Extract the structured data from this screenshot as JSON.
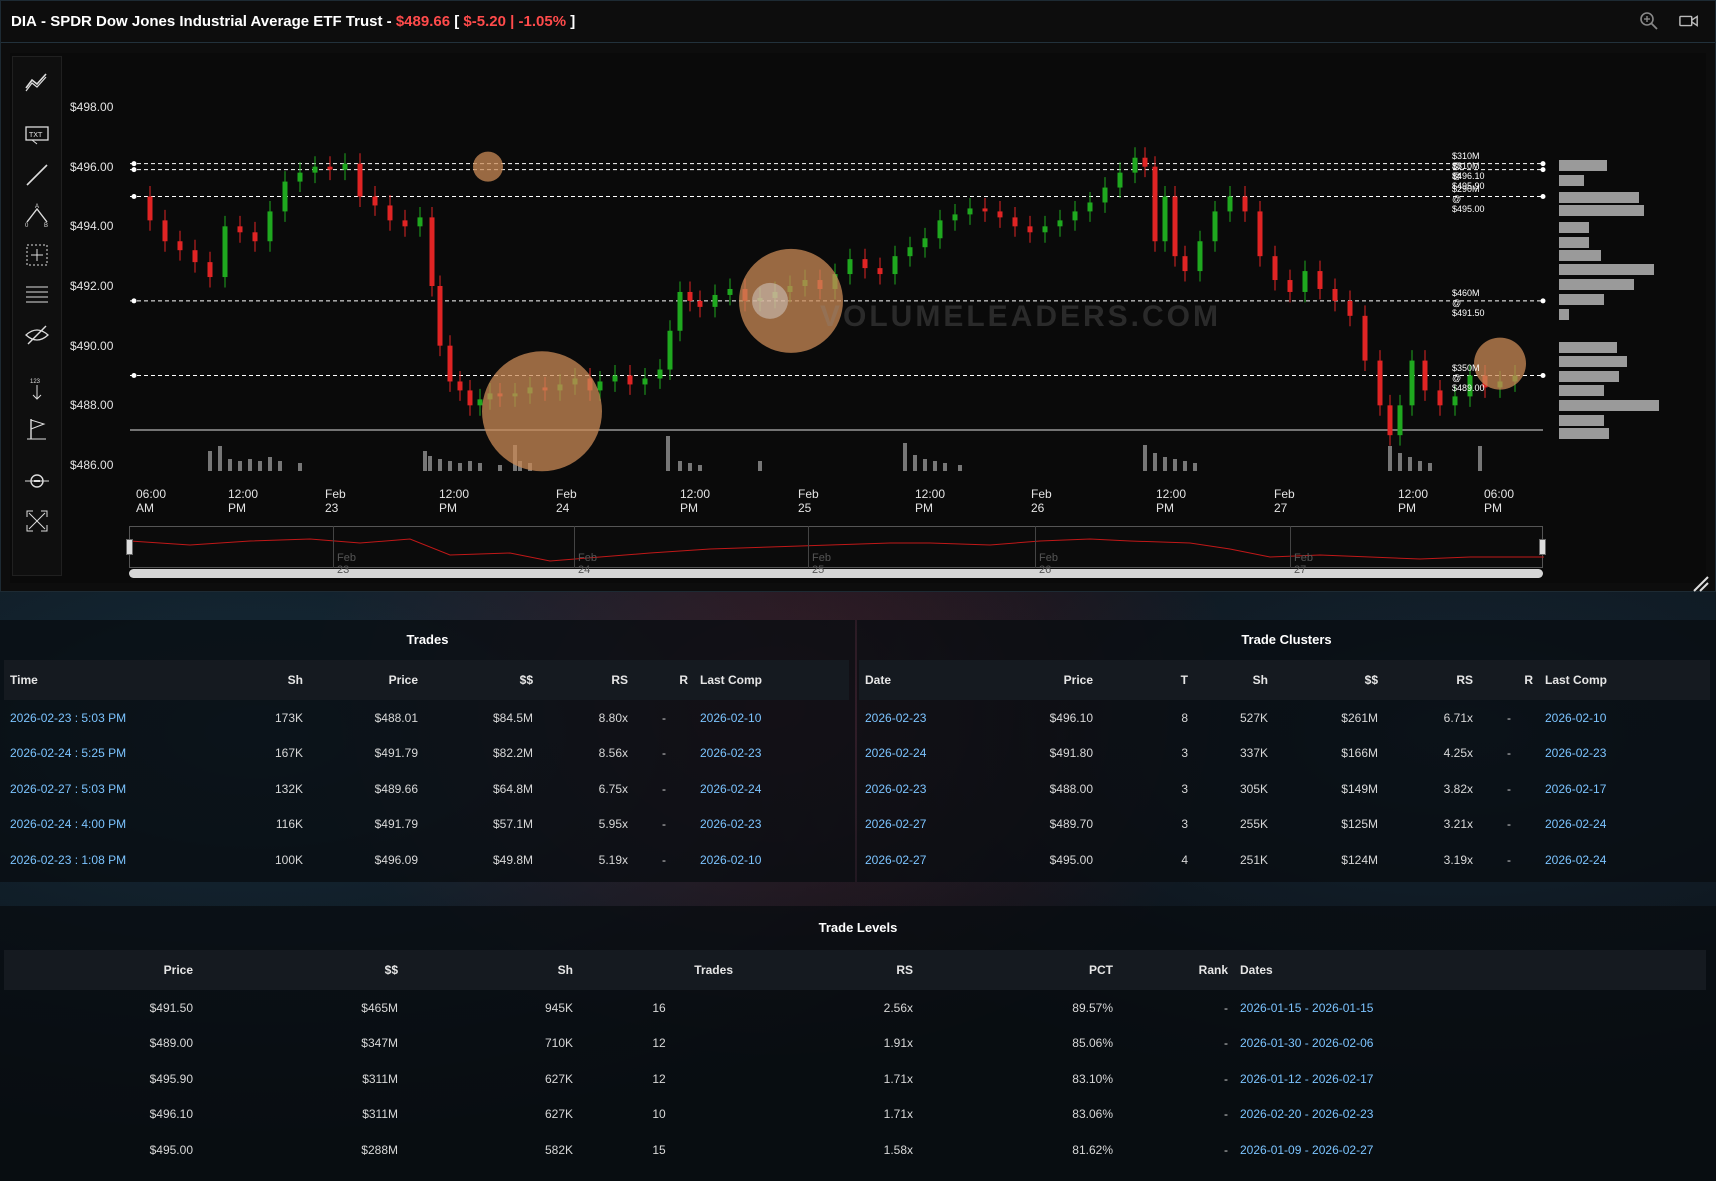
{
  "header": {
    "symbol": "DIA",
    "separator": " - ",
    "name": "SPDR Dow Jones Industrial Average ETF Trust",
    "dash": " - ",
    "price": "$489.66",
    "bracket_open": " [ ",
    "change": "$-5.20",
    "pipe": " | ",
    "change_pct": "-1.05%",
    "bracket_close": " ]"
  },
  "chart_data": {
    "type": "candlestick",
    "y_ticks": [
      "$498.00",
      "$496.00",
      "$494.00",
      "$492.00",
      "$490.00",
      "$488.00",
      "$486.00"
    ],
    "x_ticks": [
      "06:00 AM",
      "12:00 PM",
      "Feb 23",
      "12:00 PM",
      "Feb 24",
      "12:00 PM",
      "Feb 25",
      "12:00 PM",
      "Feb 26",
      "12:00 PM",
      "Feb 27",
      "12:00 PM",
      "06:00 PM"
    ],
    "ylim": [
      486,
      498.5
    ],
    "levels": [
      {
        "label": "$310M @ $496.10",
        "price": 496.1
      },
      {
        "label": "$310M @ $495.90",
        "price": 495.9
      },
      {
        "label": "$290M @ $495.00",
        "price": 495.0
      },
      {
        "label": "$460M @ $491.50",
        "price": 491.5
      },
      {
        "label": "$350M @ $489.00",
        "price": 489.0
      }
    ],
    "watermark": "VOLUMELEADERS.COM",
    "navigator_labels": [
      "Feb 23",
      "Feb 24",
      "Feb 25",
      "Feb 26",
      "Feb 27"
    ],
    "colors": {
      "up": "#1fa81f",
      "down": "#e02424",
      "bubble": "#c98a55"
    }
  },
  "trades": {
    "title": "Trades",
    "columns": [
      "Time",
      "Sh",
      "Price",
      "$$",
      "RS",
      "R",
      "Last Comp"
    ],
    "rows": [
      [
        "2026-02-23 : 5:03 PM",
        "173K",
        "$488.01",
        "$84.5M",
        "8.80x",
        "-",
        "2026-02-10"
      ],
      [
        "2026-02-24 : 5:25 PM",
        "167K",
        "$491.79",
        "$82.2M",
        "8.56x",
        "-",
        "2026-02-23"
      ],
      [
        "2026-02-27 : 5:03 PM",
        "132K",
        "$489.66",
        "$64.8M",
        "6.75x",
        "-",
        "2026-02-24"
      ],
      [
        "2026-02-24 : 4:00 PM",
        "116K",
        "$491.79",
        "$57.1M",
        "5.95x",
        "-",
        "2026-02-23"
      ],
      [
        "2026-02-23 : 1:08 PM",
        "100K",
        "$496.09",
        "$49.8M",
        "5.19x",
        "-",
        "2026-02-10"
      ]
    ]
  },
  "clusters": {
    "title": "Trade Clusters",
    "columns": [
      "Date",
      "Price",
      "T",
      "Sh",
      "$$",
      "RS",
      "R",
      "Last Comp"
    ],
    "rows": [
      [
        "2026-02-23",
        "$496.10",
        "8",
        "527K",
        "$261M",
        "6.71x",
        "-",
        "2026-02-10"
      ],
      [
        "2026-02-24",
        "$491.80",
        "3",
        "337K",
        "$166M",
        "4.25x",
        "-",
        "2026-02-23"
      ],
      [
        "2026-02-23",
        "$488.00",
        "3",
        "305K",
        "$149M",
        "3.82x",
        "-",
        "2026-02-17"
      ],
      [
        "2026-02-27",
        "$489.70",
        "3",
        "255K",
        "$125M",
        "3.21x",
        "-",
        "2026-02-24"
      ],
      [
        "2026-02-27",
        "$495.00",
        "4",
        "251K",
        "$124M",
        "3.19x",
        "-",
        "2026-02-24"
      ]
    ]
  },
  "levels": {
    "title": "Trade Levels",
    "columns": [
      "Price",
      "$$",
      "Sh",
      "Trades",
      "RS",
      "PCT",
      "Rank",
      "Dates"
    ],
    "rows": [
      [
        "$491.50",
        "$465M",
        "945K",
        "16",
        "2.56x",
        "89.57%",
        "-",
        "2026-01-15 - 2026-01-15"
      ],
      [
        "$489.00",
        "$347M",
        "710K",
        "12",
        "1.91x",
        "85.06%",
        "-",
        "2026-01-30 - 2026-02-06"
      ],
      [
        "$495.90",
        "$311M",
        "627K",
        "12",
        "1.71x",
        "83.10%",
        "-",
        "2026-01-12 - 2026-02-17"
      ],
      [
        "$496.10",
        "$311M",
        "627K",
        "10",
        "1.71x",
        "83.06%",
        "-",
        "2026-02-20 - 2026-02-23"
      ],
      [
        "$495.00",
        "$288M",
        "582K",
        "15",
        "1.58x",
        "81.62%",
        "-",
        "2026-01-09 - 2026-02-27"
      ]
    ]
  }
}
